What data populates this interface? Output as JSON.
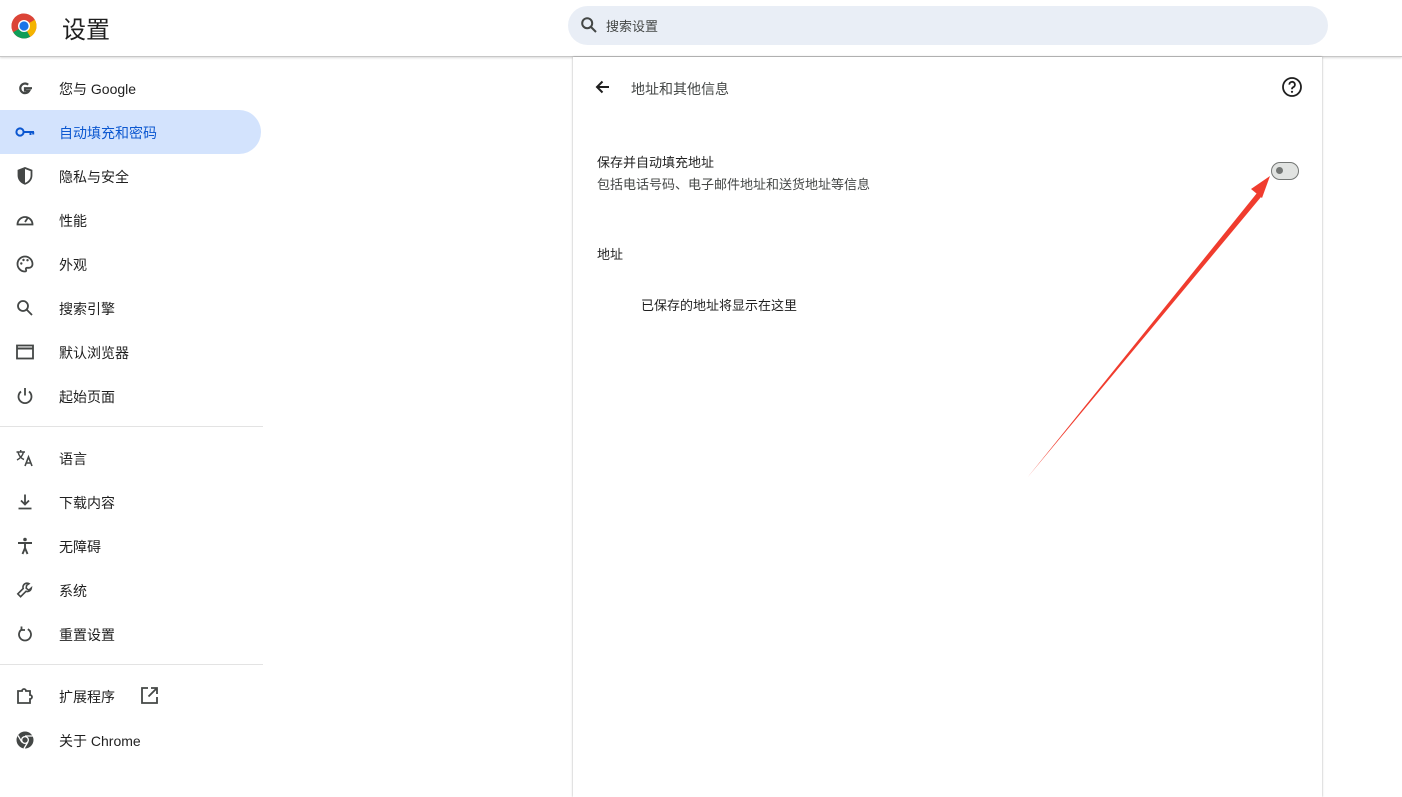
{
  "header": {
    "title": "设置",
    "search_placeholder": "搜索设置"
  },
  "sidebar": {
    "items": [
      {
        "label": "您与 Google",
        "icon": "google-g-icon"
      },
      {
        "label": "自动填充和密码",
        "icon": "key-icon",
        "active": true
      },
      {
        "label": "隐私与安全",
        "icon": "shield-icon"
      },
      {
        "label": "性能",
        "icon": "speedometer-icon"
      },
      {
        "label": "外观",
        "icon": "palette-icon"
      },
      {
        "label": "搜索引擎",
        "icon": "search-icon"
      },
      {
        "label": "默认浏览器",
        "icon": "browser-window-icon"
      },
      {
        "label": "起始页面",
        "icon": "power-icon"
      },
      {
        "label": "语言",
        "icon": "translate-icon"
      },
      {
        "label": "下载内容",
        "icon": "download-icon"
      },
      {
        "label": "无障碍",
        "icon": "accessibility-icon"
      },
      {
        "label": "系统",
        "icon": "wrench-icon"
      },
      {
        "label": "重置设置",
        "icon": "reset-icon"
      },
      {
        "label": "扩展程序",
        "icon": "puzzle-icon"
      },
      {
        "label": "关于 Chrome",
        "icon": "chrome-icon"
      }
    ]
  },
  "main": {
    "page_title": "地址和其他信息",
    "setting": {
      "title": "保存并自动填充地址",
      "description": "包括电话号码、电子邮件地址和送货地址等信息",
      "enabled": false
    },
    "section_label": "地址",
    "empty_text": "已保存的地址将显示在这里"
  },
  "colors": {
    "active_bg": "#d3e3fd",
    "active_text": "#0b57d0",
    "search_bg": "#e9eef6",
    "annotation_arrow": "#f03c2e"
  }
}
